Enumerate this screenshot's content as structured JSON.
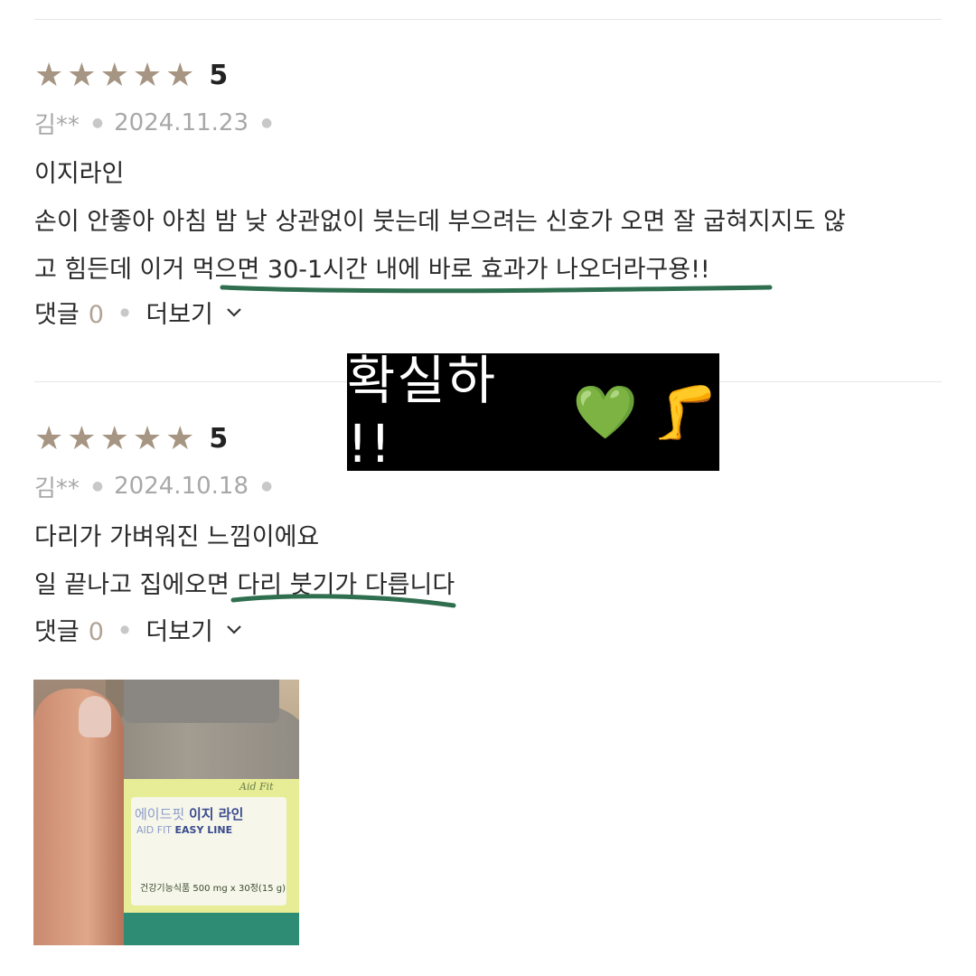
{
  "colors": {
    "star": "#a69582",
    "underline": "#2f6e4f",
    "banner_bg": "#000000",
    "banner_text": "#ffffff",
    "meta_text": "#a8a8a8",
    "count_text": "#b0a394"
  },
  "reviews": [
    {
      "stars": 5,
      "score": "5",
      "author": "김**",
      "date": "2024.11.23",
      "title": "이지라인",
      "lines": [
        "손이 안좋아 아침 밤 낮 상관없이 붓는데 부으려는 신호가 오면 잘 굽혀지지도 않",
        "고 힘든데 이거 먹으면 30-1시간 내에 바로 효과가 나오더라구용!!"
      ],
      "comments_label": "댓글",
      "comments_count": "0",
      "more_label": "더보기"
    },
    {
      "stars": 5,
      "score": "5",
      "author": "김**",
      "date": "2024.10.18",
      "title": "다리가 가벼워진 느낌이에요",
      "lines": [
        "일 끝나고 집에오면 다리 붓기가 다릅니다"
      ],
      "comments_label": "댓글",
      "comments_count": "0",
      "more_label": "더보기"
    }
  ],
  "overlay": {
    "text": "확실하 !!",
    "heart": "💚",
    "leg": "🦵"
  },
  "photo": {
    "brand": "Aid Fit",
    "name_ko_light": "에이드핏",
    "name_ko_bold": "이지 라인",
    "name_en_light": "AID FIT",
    "name_en_bold": "EASY LINE",
    "dose": "건강기능식품 500 mg x 30정(15 g)"
  }
}
